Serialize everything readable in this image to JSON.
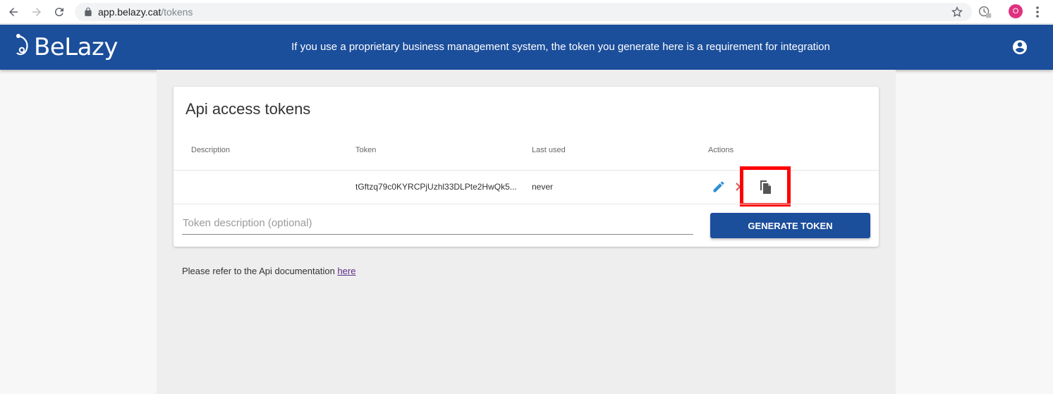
{
  "browser": {
    "url_host": "app.belazy.cat",
    "url_path": "/tokens",
    "profile_initial": "O"
  },
  "header": {
    "logo_text": "BeLazy",
    "message": "If you use a proprietary business management system, the token you generate here is a requirement for integration"
  },
  "card": {
    "title": "Api access tokens",
    "columns": [
      "Description",
      "Token",
      "Last used",
      "Actions"
    ],
    "rows": [
      {
        "description": "",
        "token": "tGftzq79c0KYRCPjUzhl33DLPte2HwQk5...",
        "last_used": "never"
      }
    ],
    "input_placeholder": "Token description (optional)",
    "generate_label": "GENERATE TOKEN"
  },
  "footer": {
    "note_prefix": "Please refer to the Api documentation",
    "link_text": "here"
  },
  "colors": {
    "brand": "#1b4e9b",
    "highlight": "#ff0000",
    "edit": "#2b8fd6",
    "delete": "#d9534f"
  }
}
